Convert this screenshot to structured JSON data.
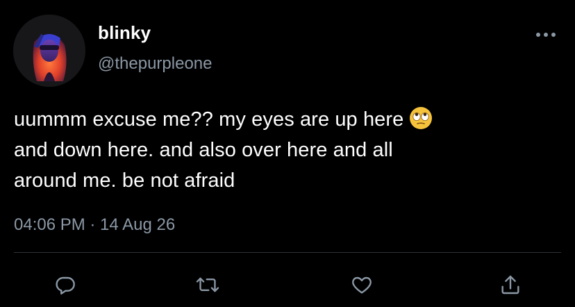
{
  "author": {
    "display_name": "blinky",
    "handle": "@thepurpleone",
    "avatar_icon": "profile-photo"
  },
  "tweet": {
    "text_lines": [
      "uummm excuse me?? my eyes are up here",
      "and down here. and also over here and all",
      "around me. be not afraid"
    ],
    "emoji": "face-with-rolling-eyes",
    "timestamp": "04:06 PM · 14 Aug 26"
  },
  "actions": {
    "more_icon": "more-options-icon",
    "reply_icon": "reply-icon",
    "retweet_icon": "retweet-icon",
    "like_icon": "heart-icon",
    "share_icon": "share-icon"
  },
  "colors": {
    "background": "#000000",
    "text_primary": "#ffffff",
    "text_secondary": "#8b98a5",
    "divider": "#2f3336",
    "icon": "#8b98a5"
  }
}
